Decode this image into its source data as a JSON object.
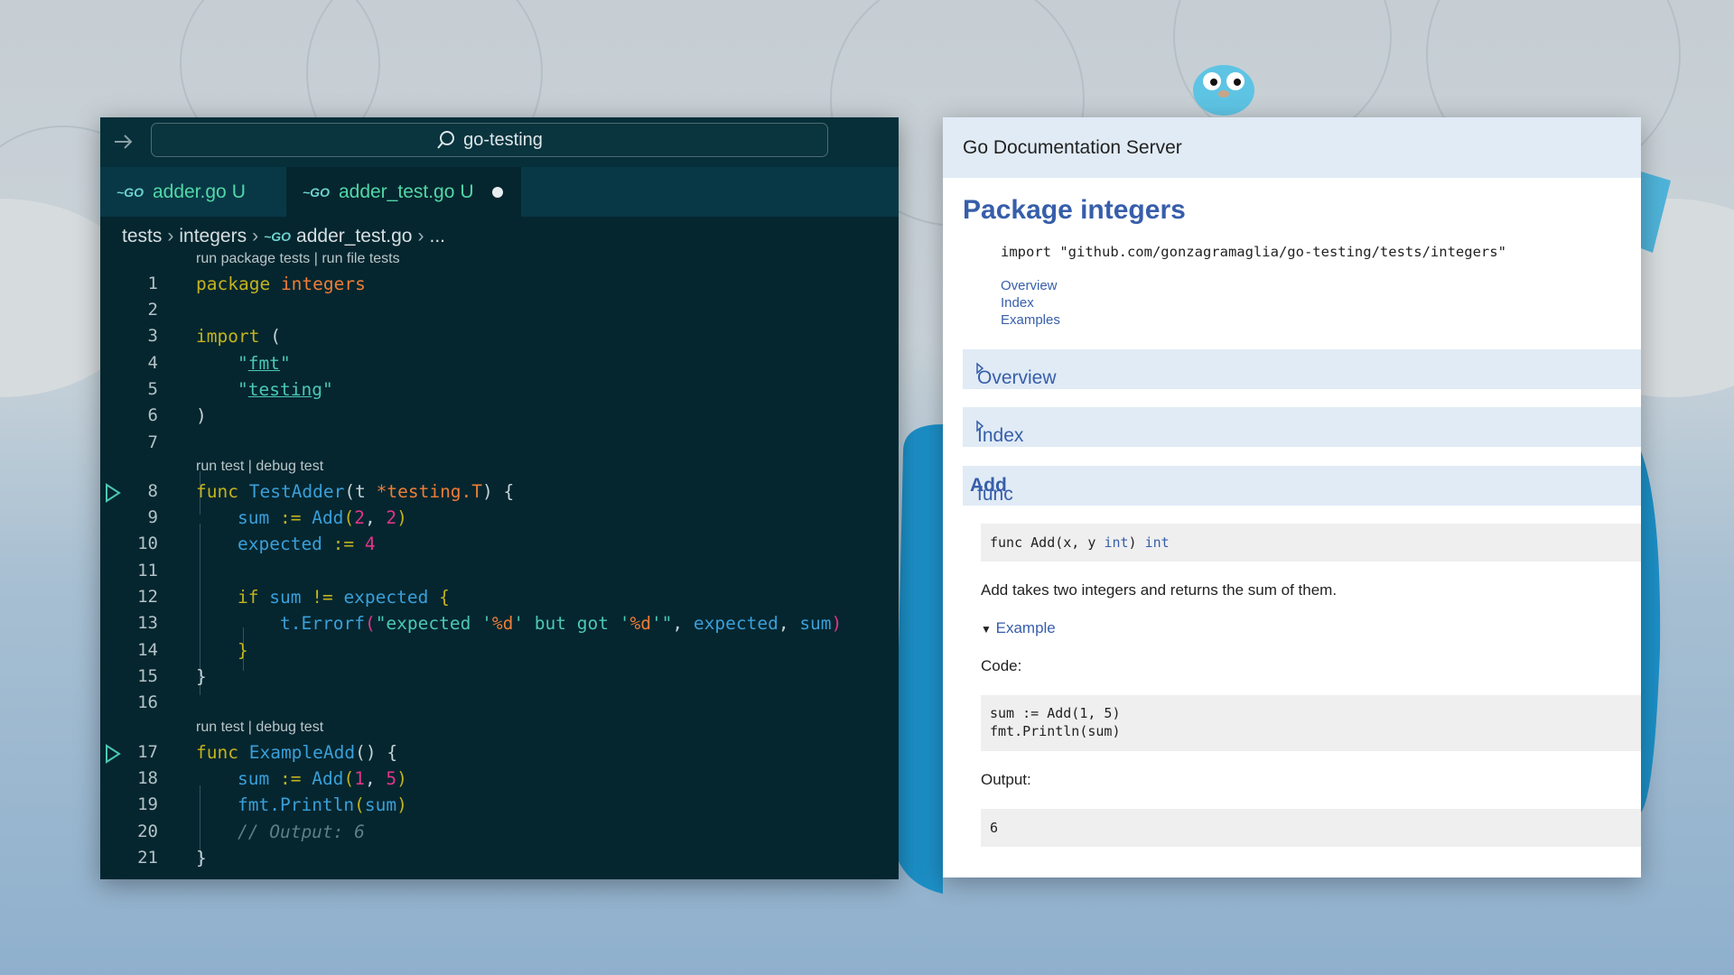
{
  "editor": {
    "command_center": "go-testing",
    "tabs": [
      {
        "name": "adder.go",
        "status": "U"
      },
      {
        "name": "adder_test.go",
        "status": "U"
      }
    ],
    "breadcrumb": [
      "tests",
      "integers",
      "adder_test.go",
      "..."
    ],
    "lenses": {
      "package": "run package tests | run file tests",
      "test1": "run test | debug test",
      "test2": "run test | debug test"
    },
    "line_numbers": [
      "1",
      "2",
      "3",
      "4",
      "5",
      "6",
      "7",
      "8",
      "9",
      "10",
      "11",
      "12",
      "13",
      "14",
      "15",
      "16",
      "17",
      "18",
      "19",
      "20",
      "21"
    ],
    "code": {
      "l1": {
        "kw": "package",
        "name": "integers"
      },
      "l3": {
        "kw": "import",
        "paren": "("
      },
      "l4": {
        "q1": "\"",
        "pkg": "fmt",
        "q2": "\""
      },
      "l5": {
        "q1": "\"",
        "pkg": "testing",
        "q2": "\""
      },
      "l6": ")",
      "l8": {
        "kw": "func",
        "name": "TestAdder",
        "open": "(t ",
        "ptr": "*testing.",
        "type": "T",
        "close": ") {"
      },
      "l9": {
        "var": "sum",
        "op": " := ",
        "call": "Add",
        "p1": "(",
        "a": "2",
        "comma": ", ",
        "b": "2",
        "p2": ")"
      },
      "l10": {
        "var": "expected",
        "op": " := ",
        "num": "4"
      },
      "l12": {
        "kw": "if",
        "sp": " ",
        "v1": "sum",
        "op": " != ",
        "v2": "expected",
        "brace": " {"
      },
      "l13": {
        "obj": "t.",
        "call": "Errorf",
        "p1": "(",
        "s1": "\"expected '",
        "f1": "%d",
        "s2": "' but got '",
        "f2": "%d",
        "s3": "'\"",
        "comma": ", ",
        "v1": "expected",
        "comma2": ", ",
        "v2": "sum",
        "p2": ")"
      },
      "l14": "}",
      "l15": "}",
      "l17": {
        "kw": "func",
        "name": "ExampleAdd",
        "rest": "() {"
      },
      "l18": {
        "var": "sum",
        "op": " := ",
        "call": "Add",
        "p1": "(",
        "a": "1",
        "comma": ", ",
        "b": "5",
        "p2": ")"
      },
      "l19": {
        "obj": "fmt.",
        "call": "Println",
        "p1": "(",
        "arg": "sum",
        "p2": ")"
      },
      "l20": "// Output: 6",
      "l21": "}"
    }
  },
  "doc": {
    "header": "Go Documentation Server",
    "title": "Package integers",
    "import": "import \"github.com/gonzagramaglia/go-testing/tests/integers\"",
    "toc": [
      "Overview",
      "Index",
      "Examples"
    ],
    "sections": {
      "overview": "Overview",
      "index": "Index"
    },
    "func_heading": {
      "prefix": "func ",
      "name": "Add"
    },
    "signature": {
      "text": "func Add(x, y ",
      "t1": "int",
      "mid": ") ",
      "t2": "int"
    },
    "description": "Add takes two integers and returns the sum of them.",
    "example_toggle": "Example",
    "code_label": "Code:",
    "example_code": [
      "sum := Add(1, 5)",
      "fmt.Println(sum)"
    ],
    "output_label": "Output:",
    "output": "6"
  }
}
